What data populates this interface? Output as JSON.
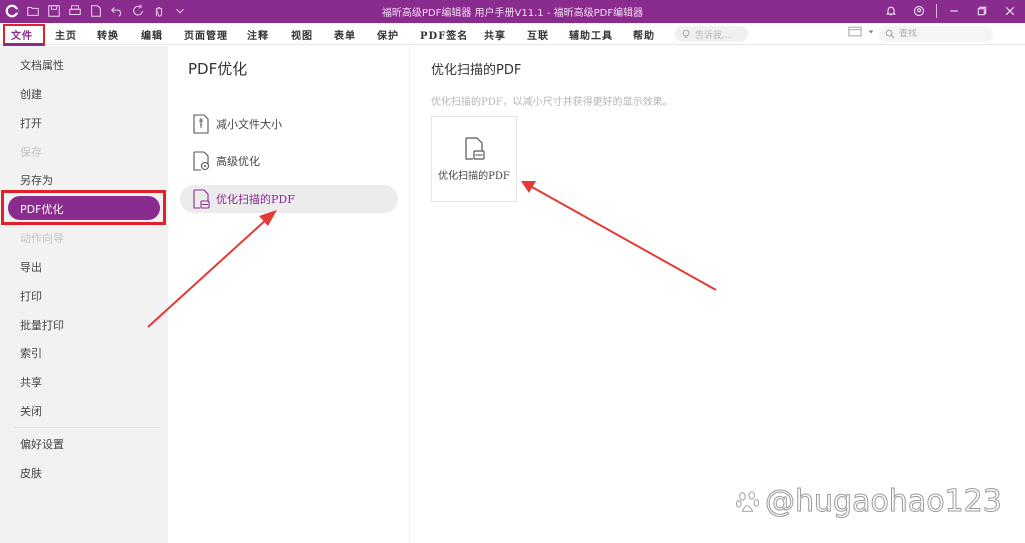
{
  "window": {
    "title": "福昕高级PDF编辑器 用户手册V11.1 - 福昕高级PDF编辑器"
  },
  "quick_access": [
    "app-logo-icon",
    "open-icon",
    "save-icon",
    "print-icon",
    "new-icon",
    "undo-icon",
    "redo-icon",
    "hand-tool-icon"
  ],
  "menu": {
    "items": [
      "文件",
      "主页",
      "转换",
      "编辑",
      "页面管理",
      "注释",
      "视图",
      "表单",
      "保护",
      "PDF签名",
      "共享",
      "互联",
      "辅助工具",
      "帮助"
    ],
    "active": "文件",
    "hint_placeholder": "告诉我...",
    "search_placeholder": "查找"
  },
  "sidebar": {
    "items": [
      {
        "label": "文档属性",
        "disabled": false
      },
      {
        "label": "创建",
        "disabled": false
      },
      {
        "label": "打开",
        "disabled": false
      },
      {
        "label": "保存",
        "disabled": true
      },
      {
        "label": "另存为",
        "disabled": false
      },
      {
        "label": "PDF优化",
        "disabled": false,
        "active": true
      },
      {
        "label": "动作向导",
        "disabled": true
      },
      {
        "label": "导出",
        "disabled": false
      },
      {
        "label": "打印",
        "disabled": false
      },
      {
        "label": "批量打印",
        "disabled": false
      },
      {
        "label": "索引",
        "disabled": false
      },
      {
        "label": "共享",
        "disabled": false
      },
      {
        "label": "关闭",
        "disabled": false
      },
      {
        "label": "偏好设置",
        "disabled": false
      },
      {
        "label": "皮肤",
        "disabled": false
      }
    ]
  },
  "middle": {
    "title": "PDF优化",
    "options": [
      {
        "label": "减小文件大小",
        "icon": "compress-file-icon"
      },
      {
        "label": "高级优化",
        "icon": "advanced-optimize-icon"
      },
      {
        "label": "优化扫描的PDF",
        "icon": "scan-optimize-icon",
        "active": true
      }
    ]
  },
  "content": {
    "title": "优化扫描的PDF",
    "description": "优化扫描的PDF，以减小尺寸并获得更好的显示效果。",
    "card_label": "优化扫描的PDF"
  },
  "watermark": {
    "text": "@hugaohao123"
  },
  "colors": {
    "brand": "#8a2b8e",
    "highlight_red": "#e0202a",
    "sidebar_bg": "#f2f2f2"
  }
}
